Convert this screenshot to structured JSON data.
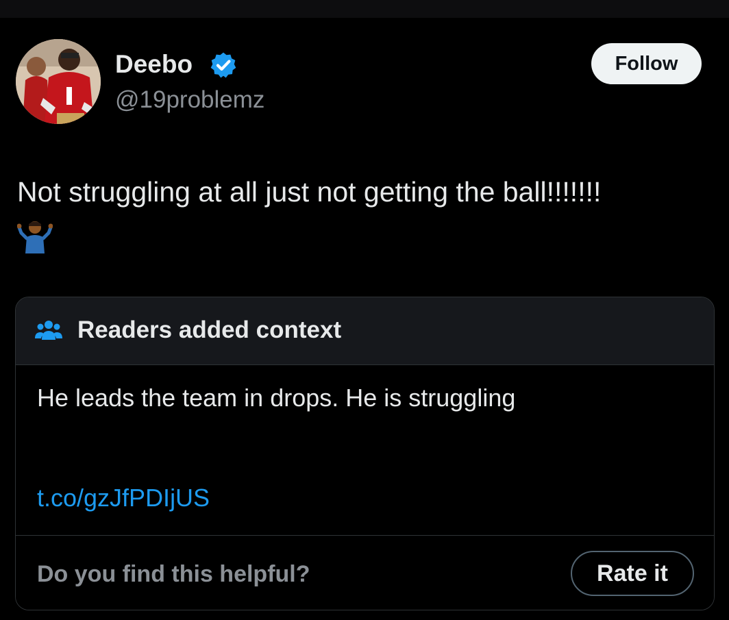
{
  "author": {
    "display_name": "Deebo",
    "handle": "@19problemz",
    "verified": true,
    "avatar_icon": "player-avatar"
  },
  "follow_button": {
    "label": "Follow"
  },
  "tweet": {
    "text": "Not struggling at all just not getting the ball!!!!!!!",
    "emoji": "🤷🏾‍♂️"
  },
  "community_note": {
    "icon": "people-icon",
    "title": "Readers added context",
    "body": "He leads the team in drops. He is struggling",
    "link": "t.co/gzJfPDIjUS",
    "helpful_question": "Do you find this helpful?",
    "rate_label": "Rate it"
  },
  "colors": {
    "background": "#000000",
    "text": "#e7e9ea",
    "secondary_text": "#8b9096",
    "link": "#1d9bf0",
    "verified_badge": "#1d9bf0",
    "card_border": "#2f3336",
    "note_header_bg": "#16181c"
  }
}
